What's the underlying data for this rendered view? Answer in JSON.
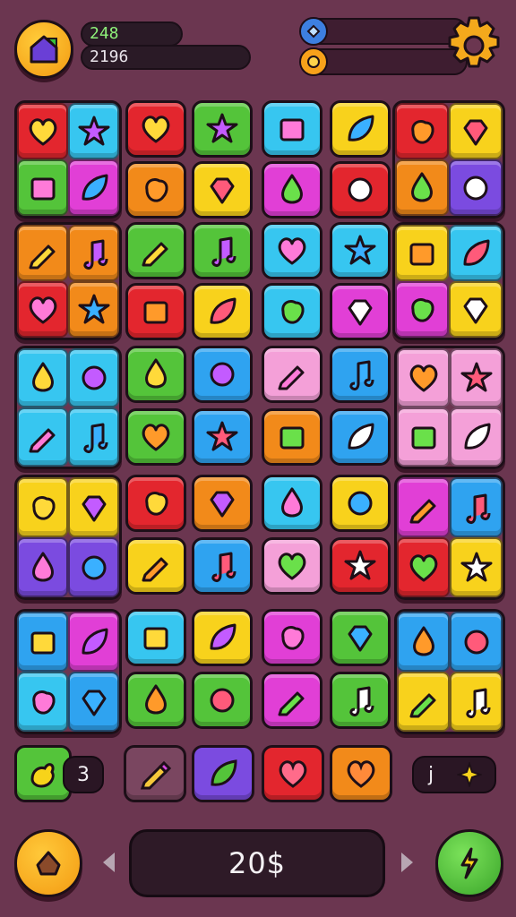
{
  "hud": {
    "primary_score": "248",
    "secondary_score": "2196",
    "home_icon": "home-icon",
    "settings_icon": "gear-icon",
    "resource_icons": [
      "gem-icon",
      "coin-icon"
    ]
  },
  "tray": {
    "left_count": "3",
    "right_label": "j"
  },
  "footer": {
    "score": "20$"
  },
  "colors": {
    "background": "#6b3650",
    "red": "#e3262e",
    "blue": "#2fa3f0",
    "cyan": "#37c6f0",
    "green": "#54c43a",
    "yellow": "#f8d21c",
    "orange": "#f28a1a",
    "magenta": "#e13fd6",
    "purple": "#7b4be0",
    "pink": "#f4a0d8"
  }
}
